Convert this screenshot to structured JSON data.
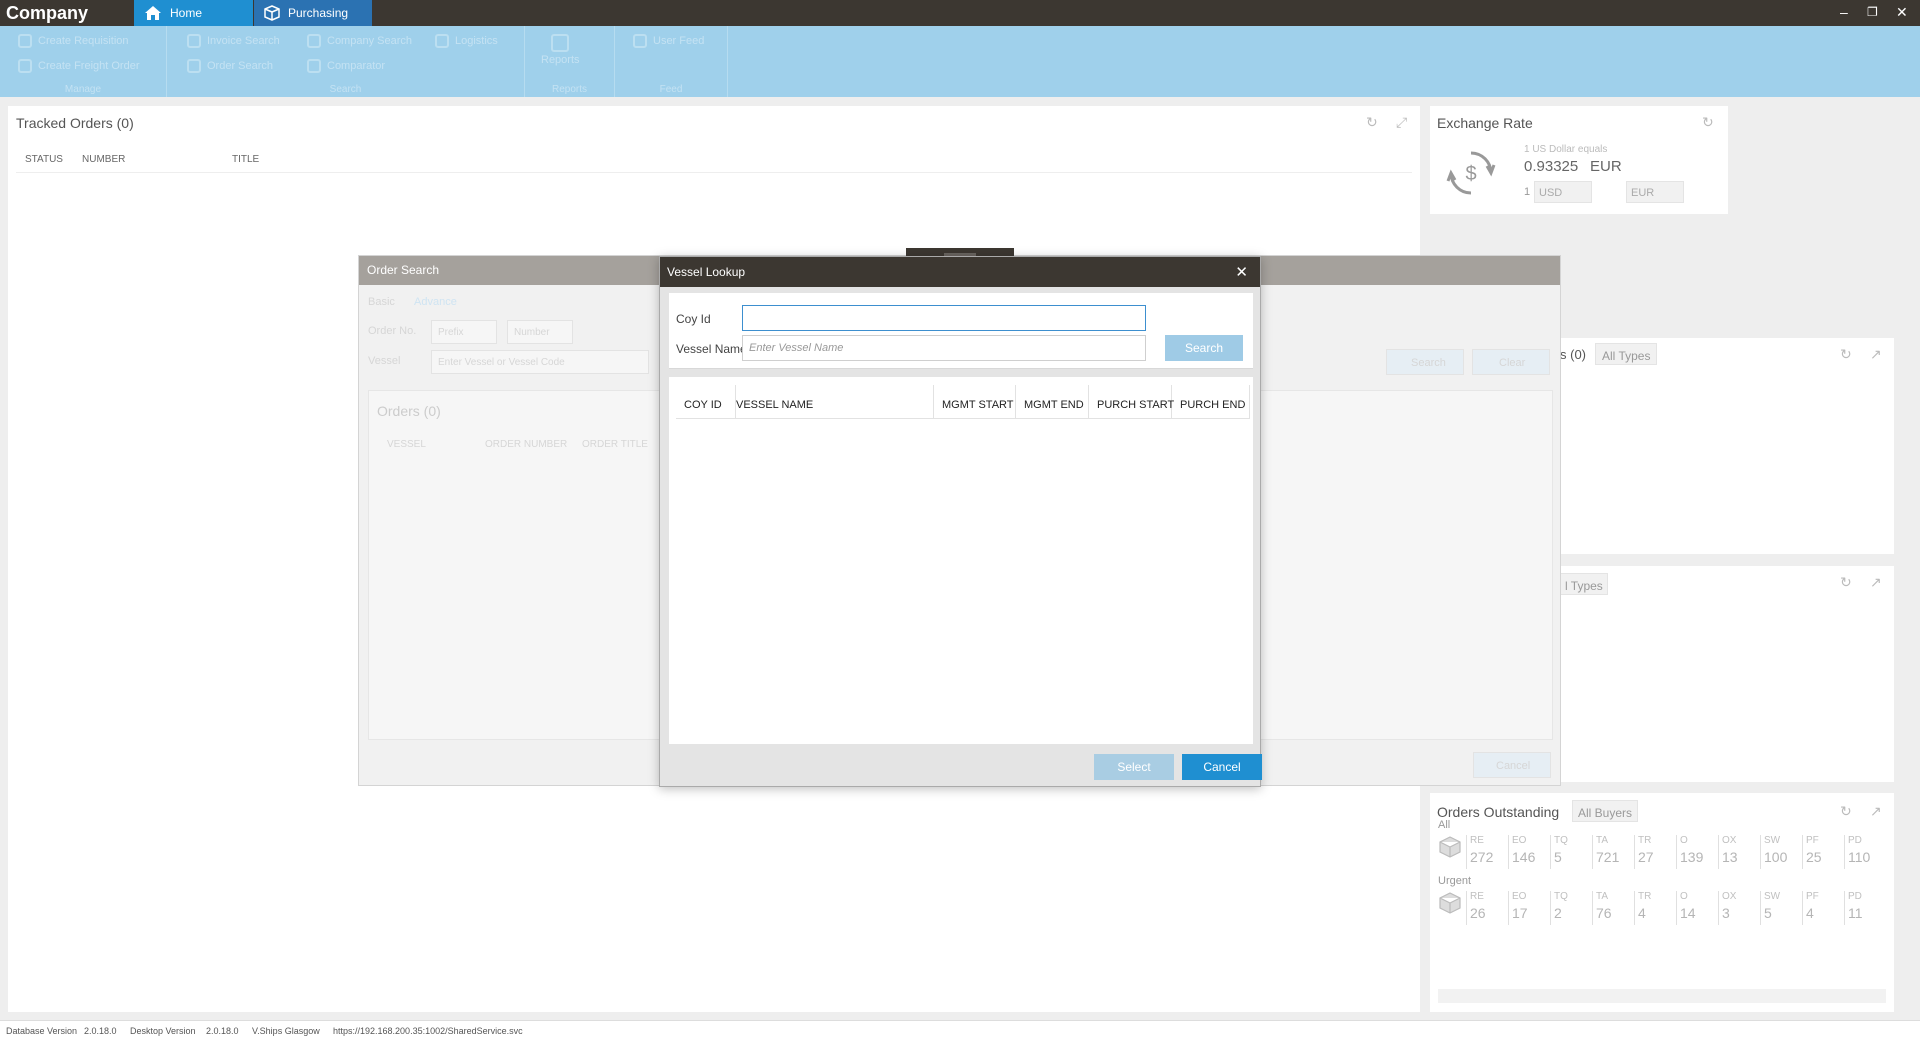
{
  "app": {
    "title": "Company"
  },
  "tabs": [
    {
      "label": "Home"
    },
    {
      "label": "Purchasing"
    }
  ],
  "ribbon": {
    "manage": {
      "label": "Manage",
      "items": [
        "Create Requisition",
        "Create Freight Order"
      ]
    },
    "search": {
      "label": "Search",
      "items": [
        "Invoice Search",
        "Order Search",
        "Company Search",
        "Comparator",
        "Logistics"
      ]
    },
    "reports": {
      "label": "Reports",
      "items": [
        "Reports"
      ]
    },
    "feed": {
      "label": "Feed",
      "items": [
        "User Feed"
      ]
    }
  },
  "tracked_orders": {
    "title": "Tracked Orders (0)",
    "columns": [
      "STATUS",
      "NUMBER",
      "TITLE"
    ]
  },
  "exchange_rate": {
    "title": "Exchange Rate",
    "subtitle": "1 US Dollar equals",
    "value": "0.93325",
    "currency": "EUR",
    "amount": "1",
    "from": "USD",
    "to": "EUR"
  },
  "panels": {
    "p1_suffix": "s (0)",
    "p1_filter": "All Types",
    "p2_filter": "l Types"
  },
  "orders_outstanding": {
    "title": "Orders Outstanding",
    "filter": "All Buyers",
    "groups": [
      {
        "label": "All",
        "codes": [
          "RE",
          "EO",
          "TQ",
          "TA",
          "TR",
          "O",
          "OX",
          "SW",
          "PF",
          "PD"
        ],
        "values": [
          "272",
          "146",
          "5",
          "721",
          "27",
          "139",
          "13",
          "100",
          "25",
          "110"
        ]
      },
      {
        "label": "Urgent",
        "codes": [
          "RE",
          "EO",
          "TQ",
          "TA",
          "TR",
          "O",
          "OX",
          "SW",
          "PF",
          "PD"
        ],
        "values": [
          "26",
          "17",
          "2",
          "76",
          "4",
          "14",
          "3",
          "5",
          "4",
          "11"
        ]
      }
    ]
  },
  "order_search": {
    "title": "Order Search",
    "tabs": [
      "Basic",
      "Advance"
    ],
    "labels": {
      "order_no": "Order No.",
      "vessel": "Vessel"
    },
    "placeholders": {
      "prefix": "Prefix",
      "number": "Number",
      "vessel": "Enter Vessel or Vessel Code"
    },
    "buttons": {
      "search": "Search",
      "clear": "Clear",
      "cancel": "Cancel"
    },
    "orders_title": "Orders (0)",
    "columns": [
      "VESSEL",
      "ORDER NUMBER",
      "ORDER TITLE"
    ]
  },
  "vessel_lookup": {
    "title": "Vessel Lookup",
    "close": "✕",
    "labels": {
      "coy_id": "Coy Id",
      "vessel_name": "Vessel Name"
    },
    "coy_id_value": "",
    "vessel_name_placeholder": "Enter Vessel Name",
    "buttons": {
      "search": "Search",
      "select": "Select",
      "cancel": "Cancel"
    },
    "columns": [
      "COY ID",
      "VESSEL NAME",
      "MGMT START",
      "MGMT END",
      "PURCH START",
      "PURCH END"
    ]
  },
  "statusbar": {
    "db_label": "Database Version",
    "db_version": "2.0.18.0",
    "desktop_label": "Desktop Version",
    "desktop_version": "2.0.18.0",
    "office": "V.Ships Glasgow",
    "url": "https://192.168.200.35:1002/SharedService.svc"
  },
  "colors": {
    "accent": "#1f8fd1",
    "titlebar": "#3c3731",
    "ribbon": "#9fd0eb"
  },
  "icons": [
    "home-icon",
    "box-icon",
    "minimize-icon",
    "restore-icon",
    "close-icon",
    "refresh-icon",
    "expand-icon",
    "dollar-exchange-icon",
    "package-icon"
  ]
}
